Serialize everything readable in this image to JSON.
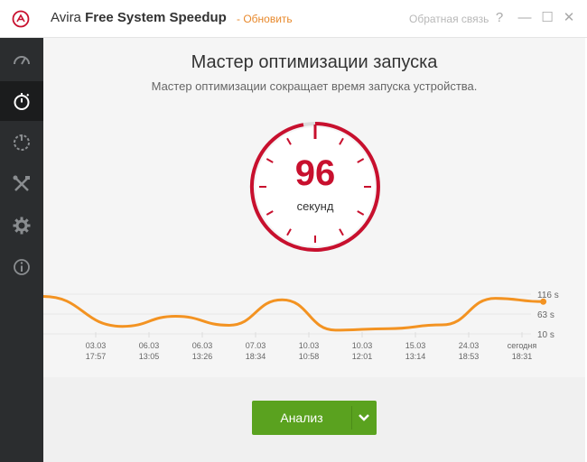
{
  "app": {
    "brand": "Avira",
    "product": "Free System Speedup",
    "update_link": "- Обновить",
    "feedback_link": "Обратная связь",
    "accent_color": "#c8102e",
    "icons": {
      "logo": "avira-umbrella-icon",
      "help": "help-icon",
      "minimize": "minimize-icon",
      "maximize": "maximize-icon",
      "close": "close-icon"
    }
  },
  "window_controls": {
    "help": "?",
    "minimize": "—",
    "maximize": "☐",
    "close": "✕"
  },
  "sidebar": {
    "items": [
      {
        "icon": "speedometer-icon",
        "active": false
      },
      {
        "icon": "stopwatch-icon",
        "active": true
      },
      {
        "icon": "power-icon",
        "active": false
      },
      {
        "icon": "tools-icon",
        "active": false
      },
      {
        "icon": "gear-icon",
        "active": false
      },
      {
        "icon": "info-icon",
        "active": false
      }
    ]
  },
  "main": {
    "title": "Мастер оптимизации запуска",
    "subtitle": "Мастер оптимизации сокращает время запуска устройства.",
    "dial": {
      "value": "96",
      "unit": "секунд"
    }
  },
  "chart_data": {
    "type": "line",
    "categories": [
      [
        "03.03",
        "17:57"
      ],
      [
        "06.03",
        "13:05"
      ],
      [
        "06.03",
        "13:26"
      ],
      [
        "07.03",
        "18:34"
      ],
      [
        "10.03",
        "10:58"
      ],
      [
        "10.03",
        "12:01"
      ],
      [
        "15.03",
        "13:14"
      ],
      [
        "24.03",
        "18:53"
      ],
      [
        "сегодня",
        "18:31"
      ]
    ],
    "y_tick_labels": [
      "116 s",
      "63 s",
      "10 s"
    ],
    "y_ticks": [
      116,
      63,
      10
    ],
    "ylim": [
      10,
      116
    ],
    "series": [
      {
        "color": "#f39322",
        "values": [
          110,
          30,
          57,
          33,
          101,
          20,
          24,
          34,
          105,
          96
        ]
      }
    ],
    "x_positions": [
      0,
      1,
      2,
      3,
      4,
      5,
      6,
      7,
      8,
      8.9
    ]
  },
  "footer": {
    "analyze_label": "Анализ",
    "dropdown_icon": "chevron-down-icon"
  }
}
